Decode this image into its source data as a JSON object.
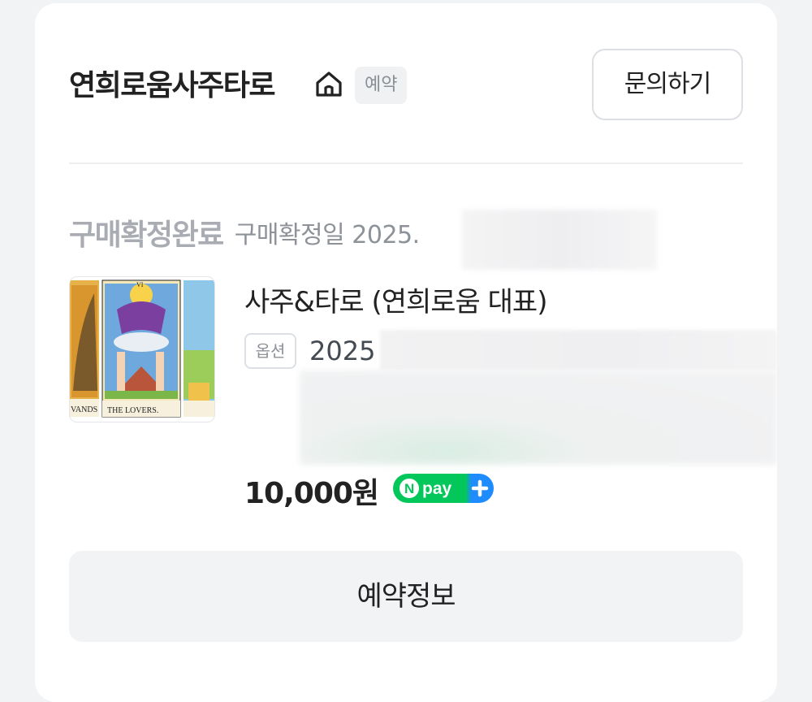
{
  "header": {
    "store_name": "연희로움사주타로",
    "store_icon": "home-icon",
    "badge": "예약",
    "inquiry_label": "문의하기"
  },
  "order": {
    "status": "구매확정완료",
    "confirm_date": "구매확정일 2025."
  },
  "product": {
    "image_caption": "THE LOVERS.",
    "image_caption_left": "VANDS",
    "image_numeral": "VI",
    "title": "사주&타로 (연희로움 대표)",
    "option_label": "옵션",
    "option_value": "2025",
    "price": "10,000원",
    "pay_badge": "Npay+"
  },
  "actions": {
    "reserve_info_label": "예약정보"
  },
  "colors": {
    "npay_green": "#03c75a",
    "npay_blue": "#1e8bff"
  }
}
